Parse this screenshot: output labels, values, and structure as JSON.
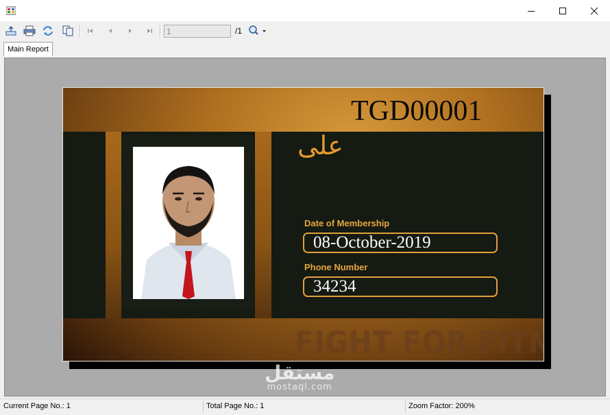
{
  "window": {
    "title": "",
    "icon": "report-app-icon",
    "controls": [
      "minimize-icon",
      "maximize-icon",
      "close-icon"
    ]
  },
  "toolbar": {
    "buttons": [
      "export-icon",
      "print-icon",
      "refresh-icon",
      "copy-icon",
      "first-page-icon",
      "previous-page-icon",
      "next-page-icon",
      "last-page-icon"
    ],
    "page_input_value": "1",
    "page_total": "/1",
    "zoom_icon": "zoom-icon"
  },
  "tabs": {
    "main_report": "Main Report"
  },
  "card": {
    "id": "TGD00001",
    "name": "على",
    "date_label": "Date of Membership",
    "date_value": "08-October-2019",
    "phone_label": "Phone Number",
    "phone_value": "34234",
    "slogan": "FIGHT FOR FITNESS",
    "accent_color": "#e3a03d",
    "dark_color": "#151a12"
  },
  "watermark": {
    "arabic": "مستقل",
    "latin": "mostaql.com"
  },
  "status": {
    "current_page": "Current Page No.: 1",
    "total_page": "Total Page No.: 1",
    "zoom_factor": "Zoom Factor: 200%"
  }
}
